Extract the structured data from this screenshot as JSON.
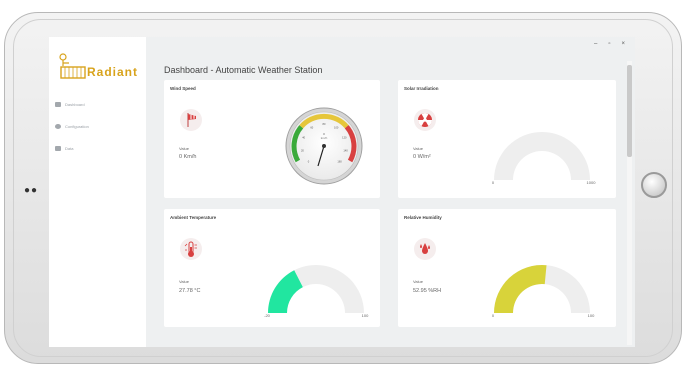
{
  "app": {
    "logo_text": "Radiant",
    "title": "Dashboard - Automatic Weather Station",
    "window_controls": {
      "minimize": "–",
      "maximize": "▫",
      "close": "×"
    }
  },
  "sidebar": {
    "items": [
      {
        "label": "Dashboard",
        "icon": "chart-icon"
      },
      {
        "label": "Configuration",
        "icon": "gear-icon"
      },
      {
        "label": "Data",
        "icon": "folder-icon"
      }
    ]
  },
  "cards": {
    "wind": {
      "title": "Wind Speed",
      "value_label": "Value",
      "value": "0 Km/h",
      "icon": "windsock-icon",
      "gauge_unit": "km/h",
      "gauge_reading": "0",
      "gauge_ticks": [
        "0",
        "20",
        "40",
        "60",
        "80",
        "100",
        "120",
        "140",
        "160"
      ]
    },
    "solar": {
      "title": "Solar Irradiation",
      "value_label": "Value",
      "value": "0 W/m²",
      "icon": "radiation-icon",
      "gauge_min": "0",
      "gauge_max": "1000",
      "gauge_fraction": 0
    },
    "temperature": {
      "title": "Ambient Temperature",
      "value_label": "Value",
      "value": "27.78 °C",
      "icon": "thermometer-icon",
      "gauge_min": "-20",
      "gauge_max": "100",
      "gauge_fraction": 0.35
    },
    "humidity": {
      "title": "Relative Humidity",
      "value_label": "Value",
      "value": "52.95 %RH",
      "icon": "humidity-icon",
      "gauge_min": "0",
      "gauge_max": "100",
      "gauge_fraction": 0.53
    }
  },
  "colors": {
    "temperature_fill": "#21e6a0",
    "humidity_fill": "#d8d33a",
    "track": "#eeeeee",
    "icon_red": "#d84040",
    "logo_gold": "#d8a31c"
  }
}
